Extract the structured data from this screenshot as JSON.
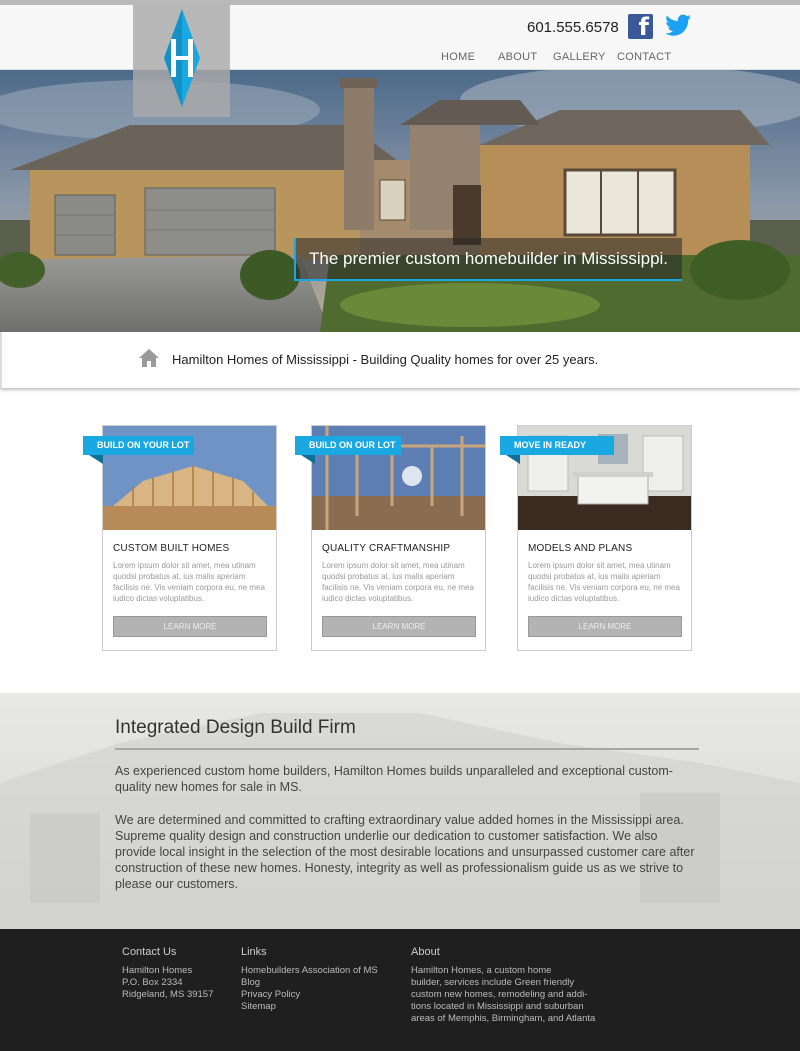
{
  "header": {
    "phone": "601.555.6578",
    "nav": [
      "HOME",
      "ABOUT",
      "GALLERY",
      "CONTACT"
    ],
    "brand_color": "#1aa8e3"
  },
  "hero": {
    "tagline": "The premier custom homebuilder in Mississippi."
  },
  "strip": {
    "text": "Hamilton Homes of Mississippi - Building Quality homes for over 25 years."
  },
  "cards": [
    {
      "ribbon": "BUILD ON YOUR LOT",
      "title": "CUSTOM BUILT HOMES",
      "body": "Lorem ipsum dolor sit amet, mea utinam quodsi probatus at, ius malis aperiam facilisis ne. Vis veniam corpora eu, ne mea iudico dictas voluptatibus.",
      "button": "LEARN MORE"
    },
    {
      "ribbon": "BUILD ON OUR LOT",
      "title": "QUALITY CRAFTMANSHIP",
      "body": "Lorem ipsum dolor sit amet, mea utinam quodsi probatus at, ius malis aperiam facilisis ne. Vis veniam corpora eu, ne mea iudico dictas voluptatibus.",
      "button": "LEARN MORE"
    },
    {
      "ribbon": "MOVE IN READY",
      "title": "MODELS AND PLANS",
      "body": "Lorem ipsum dolor sit amet, mea utinam quodsi probatus at, ius malis aperiam facilisis ne. Vis veniam corpora eu, ne mea iudico dictas voluptatibus.",
      "button": "LEARN MORE"
    }
  ],
  "about": {
    "title": "Integrated Design Build Firm",
    "para1": "As experienced custom home builders, Hamilton  Homes builds unparalleled and exceptional custom-quality new homes for sale in MS.",
    "para2": "We are determined and committed to crafting extraordinary value added homes in the Mississippi area. Supreme quality design and construction underlie our dedication to customer satisfaction. We also provide local insight in the selection of the most desirable locations and unsurpassed customer care after construction of these new homes. Honesty, integrity as well as professionalism guide us as we strive to please our customers."
  },
  "footer": {
    "contact": {
      "heading": "Contact Us",
      "lines": [
        "Hamilton Homes",
        "P.O. Box 2334",
        "Ridgeland, MS 39157"
      ]
    },
    "links": {
      "heading": "Links",
      "items": [
        "Homebuilders Association of MS",
        "Blog",
        "Privacy Policy",
        "Sitemap"
      ]
    },
    "about": {
      "heading": "About",
      "lines": [
        "Hamilton Homes, a custom home",
        "builder, services include Green friendly",
        "custom new homes, remodeling and addi-",
        "tions located in Mississippi and suburban",
        "areas of Memphis, Birmingham, and Atlanta"
      ]
    }
  }
}
